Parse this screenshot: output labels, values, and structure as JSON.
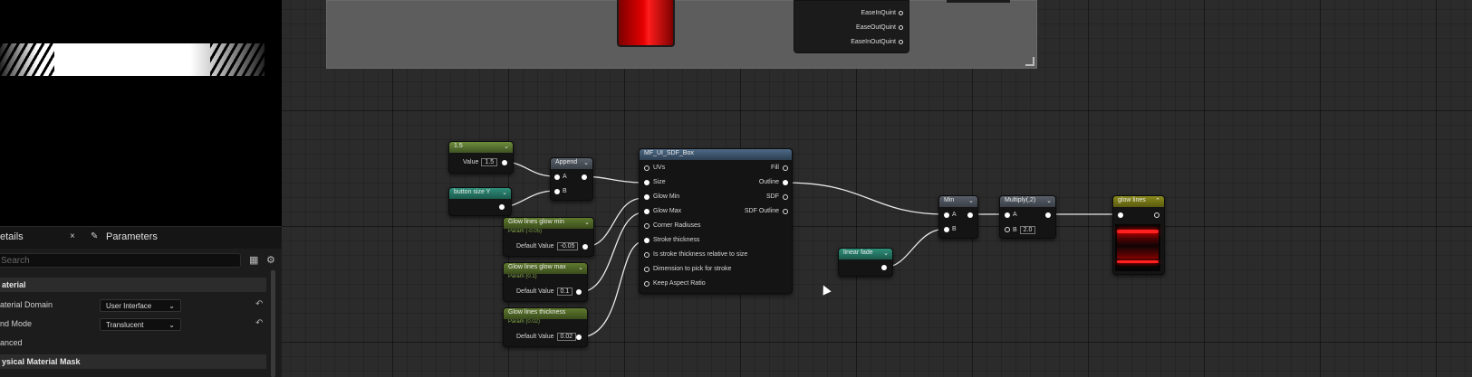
{
  "details_panel": {
    "tab_details": "etails",
    "tab_details_close": "×",
    "tab_parameters": "Parameters",
    "search_placeholder": "Search",
    "category_material": "aterial",
    "material_domain_label": "aterial Domain",
    "material_domain_value": "User Interface",
    "blend_mode_label": "nd Mode",
    "blend_mode_value": "Translucent",
    "advanced_label": "anced",
    "category_phys_mask": "ysical Material Mask"
  },
  "ease_node": {
    "outputs": [
      "EaseInQuint",
      "EaseOutQuint",
      "EaseInOutQuint"
    ]
  },
  "nodes": {
    "const_15": {
      "title": "1.5",
      "value_label": "Value",
      "value": "1.5"
    },
    "button_size": {
      "title": "button size Y"
    },
    "append": {
      "title": "Append",
      "pin_a": "A",
      "pin_b": "B"
    },
    "glow_min": {
      "title": "Glow lines glow min",
      "sub": "Param (-0.05)",
      "default_label": "Default Value",
      "value": "-0.05"
    },
    "glow_max": {
      "title": "Glow lines glow max",
      "sub": "Param (0.1)",
      "default_label": "Default Value",
      "value": "0.1"
    },
    "thickness": {
      "title": "Glow lines thickness",
      "sub": "Param (0.02)",
      "default_label": "Default Value",
      "value": "0.02"
    },
    "sdf_box": {
      "title": "MF_UI_SDF_Box",
      "inputs": [
        "UVs",
        "Size",
        "Glow Min",
        "Glow Max",
        "Corner Radiuses",
        "Stroke thickness",
        "Is stroke thickness relative to size",
        "Dimension to pick for stroke",
        "Keep Aspect Ratio"
      ],
      "outputs": [
        "Fill",
        "Outline",
        "SDF",
        "SDF Outline"
      ]
    },
    "linear_fade": {
      "title": "linear fade"
    },
    "min": {
      "title": "Min",
      "pin_a": "A",
      "pin_b": "B"
    },
    "multiply": {
      "title": "Multiply(,2)",
      "pin_a": "A",
      "pin_b": "B",
      "b_value": "2.0"
    },
    "glow_lines": {
      "title": "glow lines"
    }
  },
  "colors": {
    "preview_red": "#e50000",
    "wire": "#e8e8e8"
  }
}
